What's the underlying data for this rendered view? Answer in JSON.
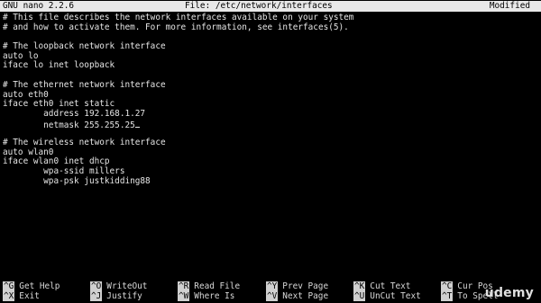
{
  "titlebar": {
    "version": "GNU nano 2.2.6",
    "file": "File: /etc/network/interfaces",
    "status": "Modified"
  },
  "editor": {
    "lines": [
      "# This file describes the network interfaces available on your system",
      "# and how to activate them. For more information, see interfaces(5).",
      "",
      "# The loopback network interface",
      "auto lo",
      "iface lo inet loopback",
      "",
      "# The ethernet network interface",
      "auto eth0",
      "iface eth0 inet static",
      "        address 192.168.1.27",
      "        netmask 255.255.25",
      "",
      "# The wireless network interface",
      "auto wlan0",
      "iface wlan0 inet dhcp",
      "        wpa-ssid millers",
      "        wpa-psk justkidding88"
    ]
  },
  "shortcuts": {
    "row1": [
      {
        "key": "^G",
        "label": "Get Help"
      },
      {
        "key": "^O",
        "label": "WriteOut"
      },
      {
        "key": "^R",
        "label": "Read File"
      },
      {
        "key": "^Y",
        "label": "Prev Page"
      },
      {
        "key": "^K",
        "label": "Cut Text"
      },
      {
        "key": "^C",
        "label": "Cur Pos"
      }
    ],
    "row2": [
      {
        "key": "^X",
        "label": "Exit"
      },
      {
        "key": "^J",
        "label": "Justify"
      },
      {
        "key": "^W",
        "label": "Where Is"
      },
      {
        "key": "^V",
        "label": "Next Page"
      },
      {
        "key": "^U",
        "label": "UnCut Text"
      },
      {
        "key": "^T",
        "label": "To Spell"
      }
    ]
  },
  "watermark": "udemy"
}
